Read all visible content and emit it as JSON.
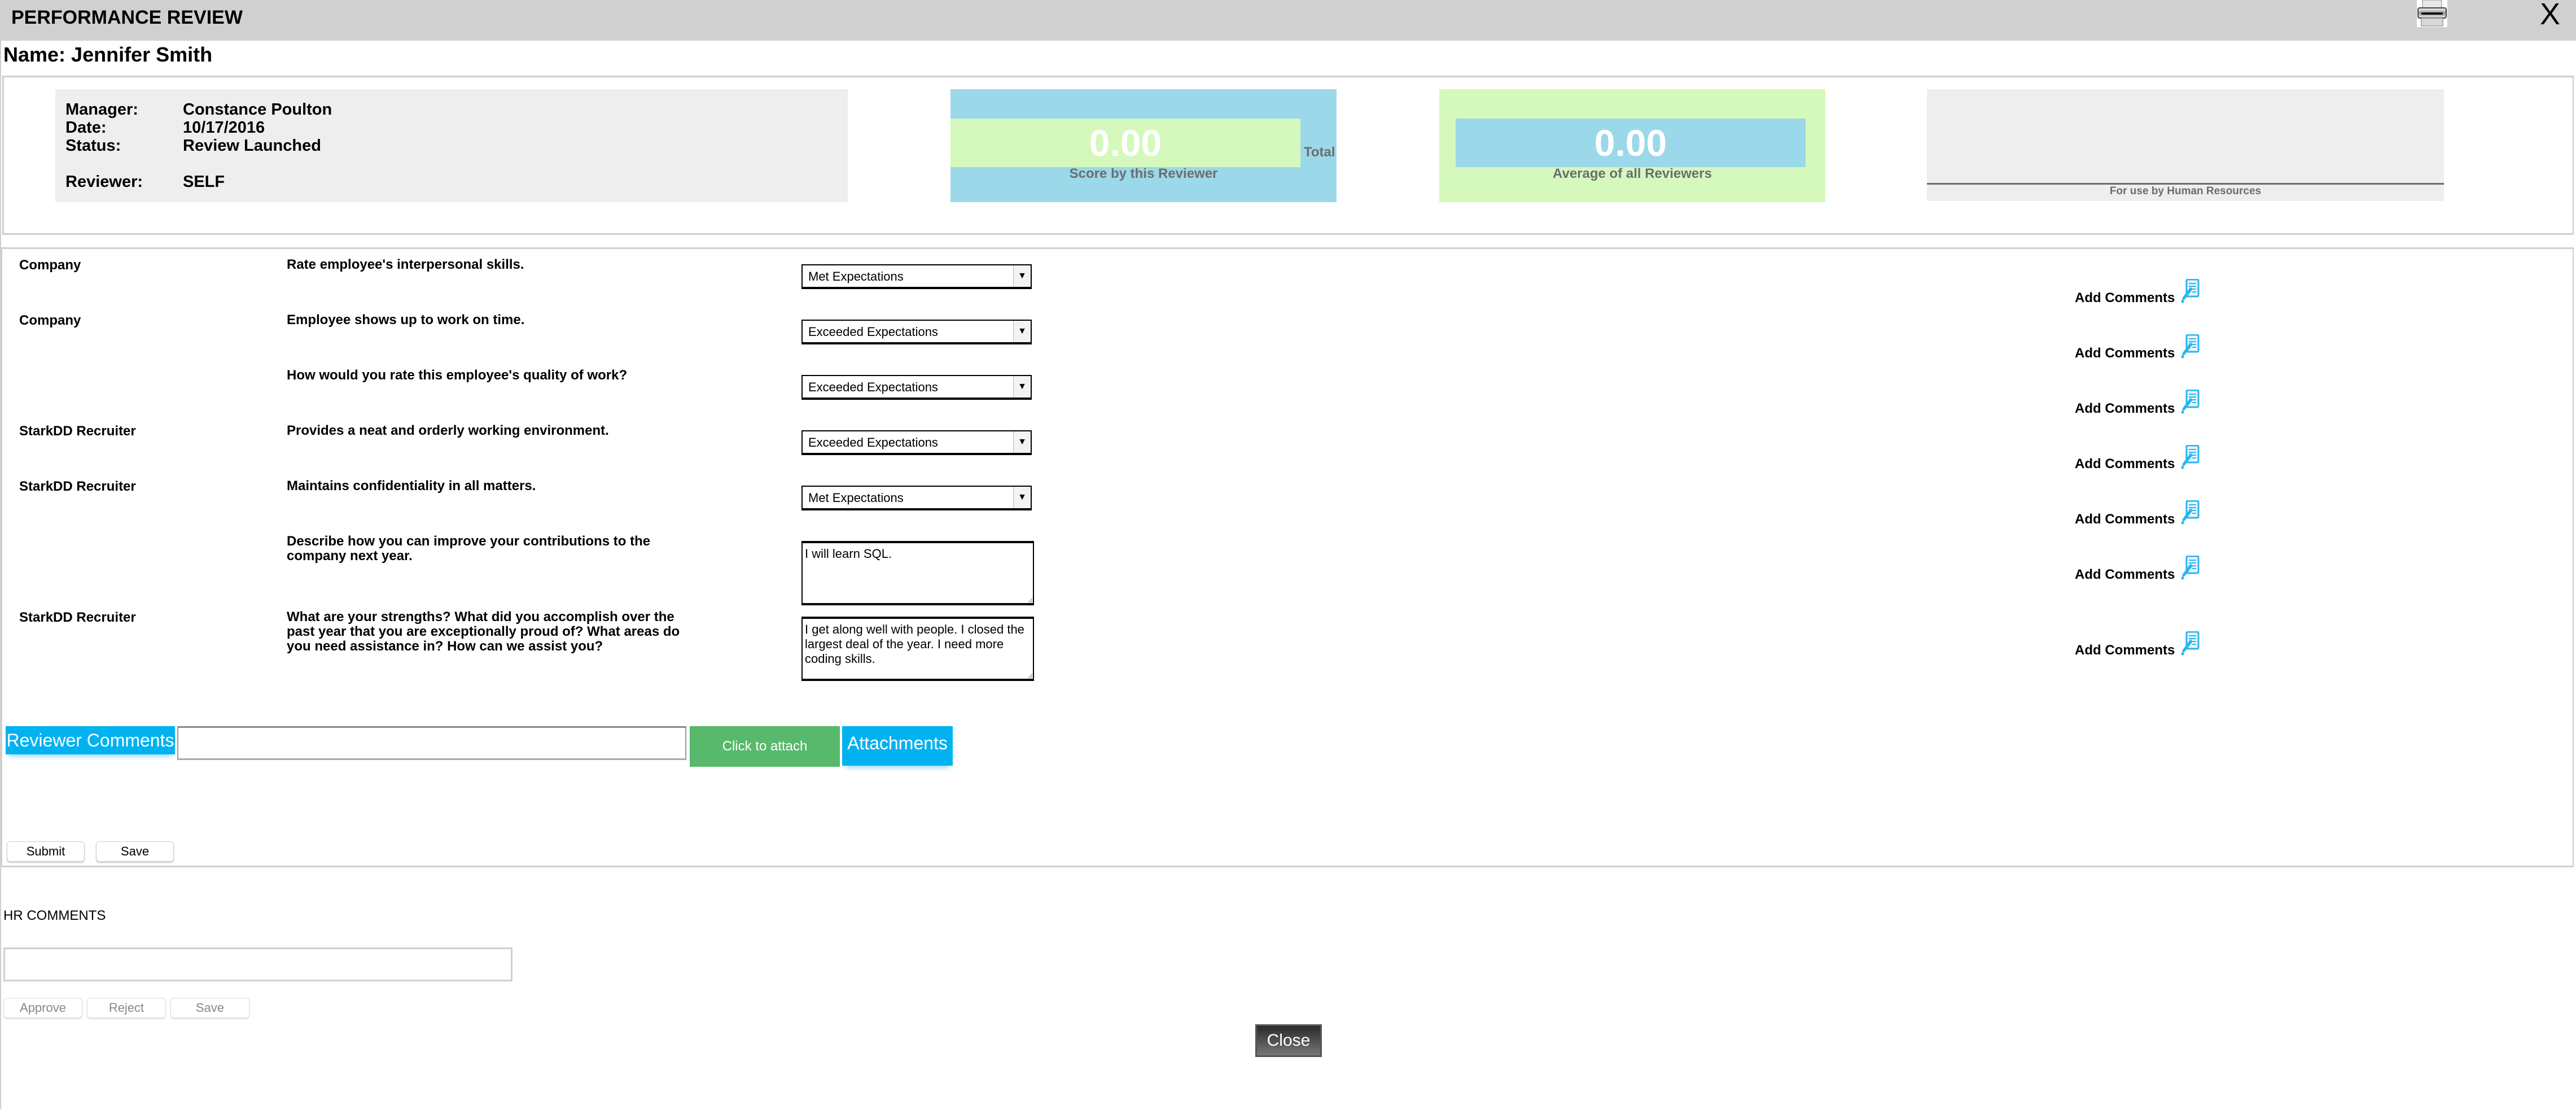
{
  "window": {
    "title": "PERFORMANCE REVIEW",
    "print_icon": "printer-icon",
    "close_label": "X"
  },
  "employee": {
    "name_line": "Name: Jennifer Smith"
  },
  "info": {
    "manager_label": "Manager:",
    "manager_value": "Constance Poulton",
    "date_label": "Date:",
    "date_value": "10/17/2016",
    "status_label": "Status:",
    "status_value": "Review Launched",
    "reviewer_label": "Reviewer:",
    "reviewer_value": "SELF"
  },
  "scores": {
    "reviewer_score": "0.00",
    "reviewer_score_label": "Score by this Reviewer",
    "total_label": "Total",
    "average_score": "0.00",
    "average_score_label": "Average of all Reviewers",
    "hr_use_label": "For use by Human Resources",
    "colors": {
      "blue": "#9bd8ea",
      "green": "#d5f8bc"
    }
  },
  "questions": [
    {
      "category": "Company",
      "text": "Rate employee's interpersonal skills.",
      "type": "select",
      "value": "Met Expectations",
      "comments_label": "Add Comments"
    },
    {
      "category": "Company",
      "text": "Employee shows up to work on time.",
      "type": "select",
      "value": "Exceeded Expectations",
      "comments_label": "Add Comments"
    },
    {
      "category": "",
      "text": "How would you rate this employee's quality of work?",
      "type": "select",
      "value": "Exceeded Expectations",
      "comments_label": "Add Comments"
    },
    {
      "category": "StarkDD Recruiter",
      "text": "Provides a neat and orderly working environment.",
      "type": "select",
      "value": "Exceeded Expectations",
      "comments_label": "Add Comments"
    },
    {
      "category": "StarkDD Recruiter",
      "text": "Maintains confidentiality in all matters.",
      "type": "select",
      "value": "Met Expectations",
      "comments_label": "Add Comments"
    },
    {
      "category": "",
      "text": "Describe how you can improve your contributions to the company next year.",
      "type": "textarea",
      "value": "I will learn SQL.",
      "comments_label": "Add Comments"
    },
    {
      "category": "StarkDD Recruiter",
      "text": "What are your strengths? What did you accomplish over the past year that you are exceptionally proud of? What areas do you need assistance in? How can we assist you?",
      "type": "textarea",
      "value": "I get along well with people. I closed the largest deal of the year. I need more coding skills.",
      "comments_label": "Add Comments"
    }
  ],
  "reviewer_section": {
    "comments_label": "Reviewer Comments",
    "comments_value": "",
    "attach_label": "Click to attach",
    "attachments_label": "Attachments",
    "submit_label": "Submit",
    "save_label": "Save",
    "colors": {
      "accent_blue": "#00b2f0",
      "attach_green": "#58b86c"
    }
  },
  "hr_section": {
    "label": "HR COMMENTS",
    "comments_value": "",
    "approve_label": "Approve",
    "reject_label": "Reject",
    "save_label": "Save"
  },
  "footer": {
    "close_label": "Close"
  }
}
